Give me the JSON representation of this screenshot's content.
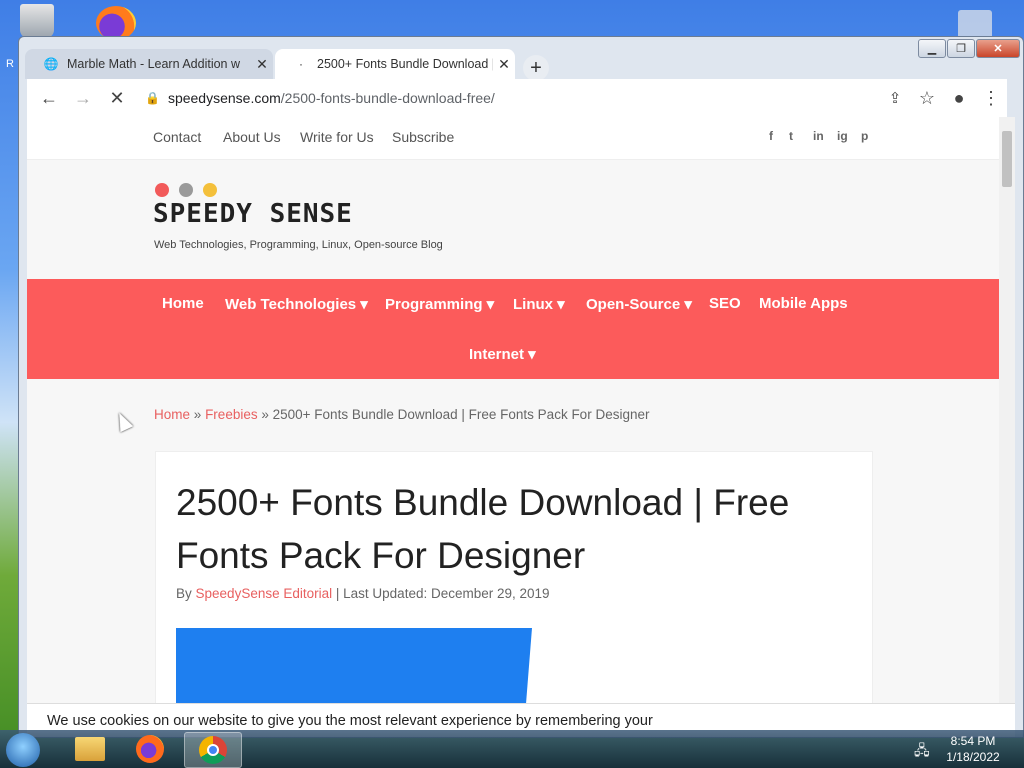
{
  "desktop": {
    "left_label": "R"
  },
  "browser": {
    "tabs": [
      {
        "title": "Marble Math - Learn Addition w",
        "close": "✕"
      },
      {
        "title": "2500+ Fonts Bundle Download |",
        "close": "✕"
      }
    ],
    "new_tab": "+",
    "url_domain": "speedysense.com",
    "url_path": "/2500-fonts-bundle-download-free/"
  },
  "site": {
    "topnav": [
      "Contact",
      "About Us",
      "Write for Us",
      "Subscribe"
    ],
    "social": [
      "f",
      "t",
      "in",
      "ig",
      "p"
    ],
    "brand": "SPEEDY SENSE",
    "tagline": "Web Technologies, Programming, Linux, Open-source Blog",
    "brand_dot_colors": [
      "#f25a5a",
      "#9a9a9a",
      "#f4c03b"
    ],
    "accent": "#fc5b5b",
    "nav": {
      "home": "Home",
      "web": "Web Technologies",
      "programming": "Programming",
      "linux": "Linux",
      "opensource": "Open-Source",
      "seo": "SEO",
      "mobile": "Mobile Apps",
      "internet": "Internet"
    },
    "breadcrumb": {
      "home": "Home",
      "sep": "»",
      "cat": "Freebies",
      "current": "2500+ Fonts Bundle Download | Free Fonts Pack For Designer"
    },
    "article": {
      "title": "2500+ Fonts Bundle Download | Free Fonts Pack For Designer",
      "by": "By",
      "author": "SpeedySense Editorial",
      "updated": "| Last Updated: December 29, 2019"
    },
    "cookie_text": "We use cookies on our website to give you the most relevant experience by remembering your"
  },
  "taskbar": {
    "time": "8:54 PM",
    "date": "1/18/2022"
  }
}
